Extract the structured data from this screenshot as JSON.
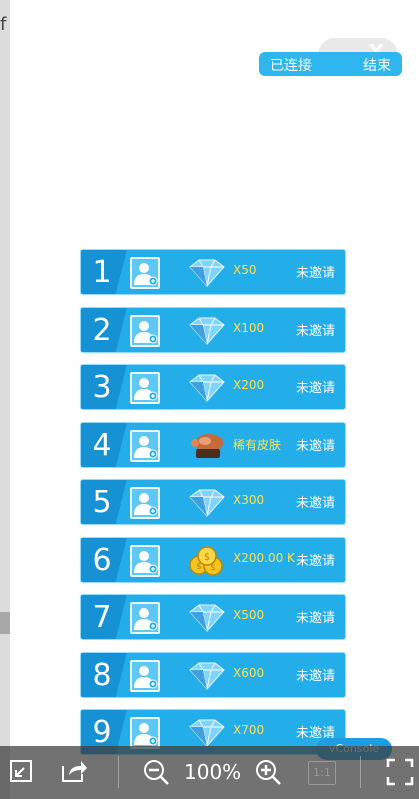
{
  "header": {
    "connection_status": "已连接",
    "end_label": "结束",
    "close_glyph": "X",
    "top_glyph": "f"
  },
  "invites": [
    {
      "rank": "1",
      "reward_icon": "diamond-icon",
      "reward": "X50",
      "status": "未邀请"
    },
    {
      "rank": "2",
      "reward_icon": "diamond-icon",
      "reward": "X100",
      "status": "未邀请"
    },
    {
      "rank": "3",
      "reward_icon": "diamond-icon",
      "reward": "X200",
      "status": "未邀请"
    },
    {
      "rank": "4",
      "reward_icon": "skin-icon",
      "reward": "稀有皮肤",
      "status": "未邀请"
    },
    {
      "rank": "5",
      "reward_icon": "diamond-icon",
      "reward": "X300",
      "status": "未邀请"
    },
    {
      "rank": "6",
      "reward_icon": "coins-icon",
      "reward": "X200.00 K",
      "status": "未邀请"
    },
    {
      "rank": "7",
      "reward_icon": "diamond-icon",
      "reward": "X500",
      "status": "未邀请"
    },
    {
      "rank": "8",
      "reward_icon": "diamond-icon",
      "reward": "X600",
      "status": "未邀请"
    },
    {
      "rank": "9",
      "reward_icon": "diamond-icon",
      "reward": "X700",
      "status": "未邀请"
    }
  ],
  "vconsole_label": "vConsole",
  "toolbar": {
    "zoom_level": "100%",
    "actual_size_label": "1:1"
  },
  "colors": {
    "row_bg": "#23aee9",
    "reward_text": "#ffe14d",
    "connection_bar": "#2fb6ee"
  }
}
